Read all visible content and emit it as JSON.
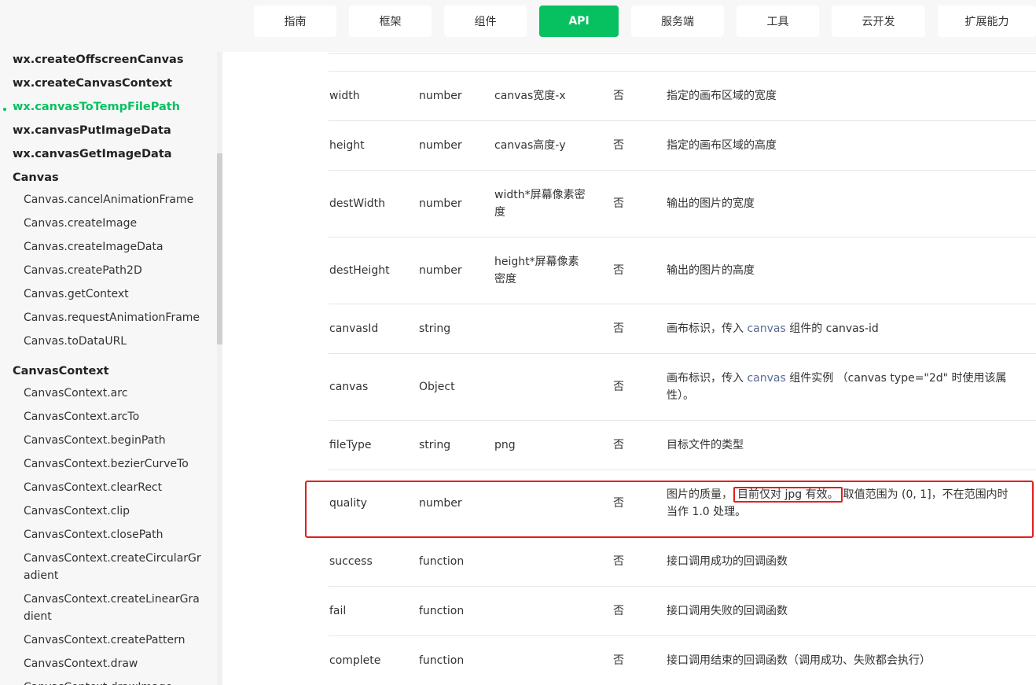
{
  "nav": {
    "items": [
      "指南",
      "框架",
      "组件",
      "API",
      "服务端",
      "工具",
      "云开发",
      "扩展能力"
    ],
    "active": "API"
  },
  "sidebar": {
    "top_items": [
      "wx.createOffscreenCanvas",
      "wx.createCanvasContext",
      "wx.canvasToTempFilePath",
      "wx.canvasPutImageData",
      "wx.canvasGetImageData"
    ],
    "active_item": "wx.canvasToTempFilePath",
    "canvas_header": "Canvas",
    "canvas_items": [
      "Canvas.cancelAnimationFrame",
      "Canvas.createImage",
      "Canvas.createImageData",
      "Canvas.createPath2D",
      "Canvas.getContext",
      "Canvas.requestAnimationFrame",
      "Canvas.toDataURL"
    ],
    "context_header": "CanvasContext",
    "context_items": [
      "CanvasContext.arc",
      "CanvasContext.arcTo",
      "CanvasContext.beginPath",
      "CanvasContext.bezierCurveTo",
      "CanvasContext.clearRect",
      "CanvasContext.clip",
      "CanvasContext.closePath",
      "CanvasContext.createCircularGr adient",
      "CanvasContext.createLinearGra dient",
      "CanvasContext.createPattern",
      "CanvasContext.draw",
      "CanvasContext.drawImage"
    ]
  },
  "table": {
    "rows": [
      {
        "name": "width",
        "type": "number",
        "default": "canvas宽度-x",
        "required": "否",
        "desc": "指定的画布区域的宽度"
      },
      {
        "name": "height",
        "type": "number",
        "default": "canvas高度-y",
        "required": "否",
        "desc": "指定的画布区域的高度"
      },
      {
        "name": "destWidth",
        "type": "number",
        "default": "width*屏幕像素密度",
        "required": "否",
        "desc": "输出的图片的宽度"
      },
      {
        "name": "destHeight",
        "type": "number",
        "default": "height*屏幕像素密度",
        "required": "否",
        "desc": "输出的图片的高度"
      },
      {
        "name": "canvasId",
        "type": "string",
        "default": "",
        "required": "否",
        "desc_pre": "画布标识，传入 ",
        "desc_link": "canvas",
        "desc_post": " 组件的 canvas-id"
      },
      {
        "name": "canvas",
        "type": "Object",
        "default": "",
        "required": "否",
        "desc_pre": "画布标识，传入 ",
        "desc_link": "canvas",
        "desc_post": " 组件实例 （canvas type=\"2d\" 时使用该属性）。"
      },
      {
        "name": "fileType",
        "type": "string",
        "default": "png",
        "required": "否",
        "desc": "目标文件的类型"
      },
      {
        "name": "quality",
        "type": "number",
        "default": "",
        "required": "否",
        "desc_pre": "图片的质量，",
        "desc_hl": "目前仅对 jpg 有效。",
        "desc_post": "取值范围为 (0, 1]，不在范围内时当作 1.0 处理。"
      },
      {
        "name": "success",
        "type": "function",
        "default": "",
        "required": "否",
        "desc": "接口调用成功的回调函数"
      },
      {
        "name": "fail",
        "type": "function",
        "default": "",
        "required": "否",
        "desc": "接口调用失败的回调函数"
      },
      {
        "name": "complete",
        "type": "function",
        "default": "",
        "required": "否",
        "desc": "接口调用结束的回调函数（调用成功、失败都会执行）"
      }
    ]
  }
}
